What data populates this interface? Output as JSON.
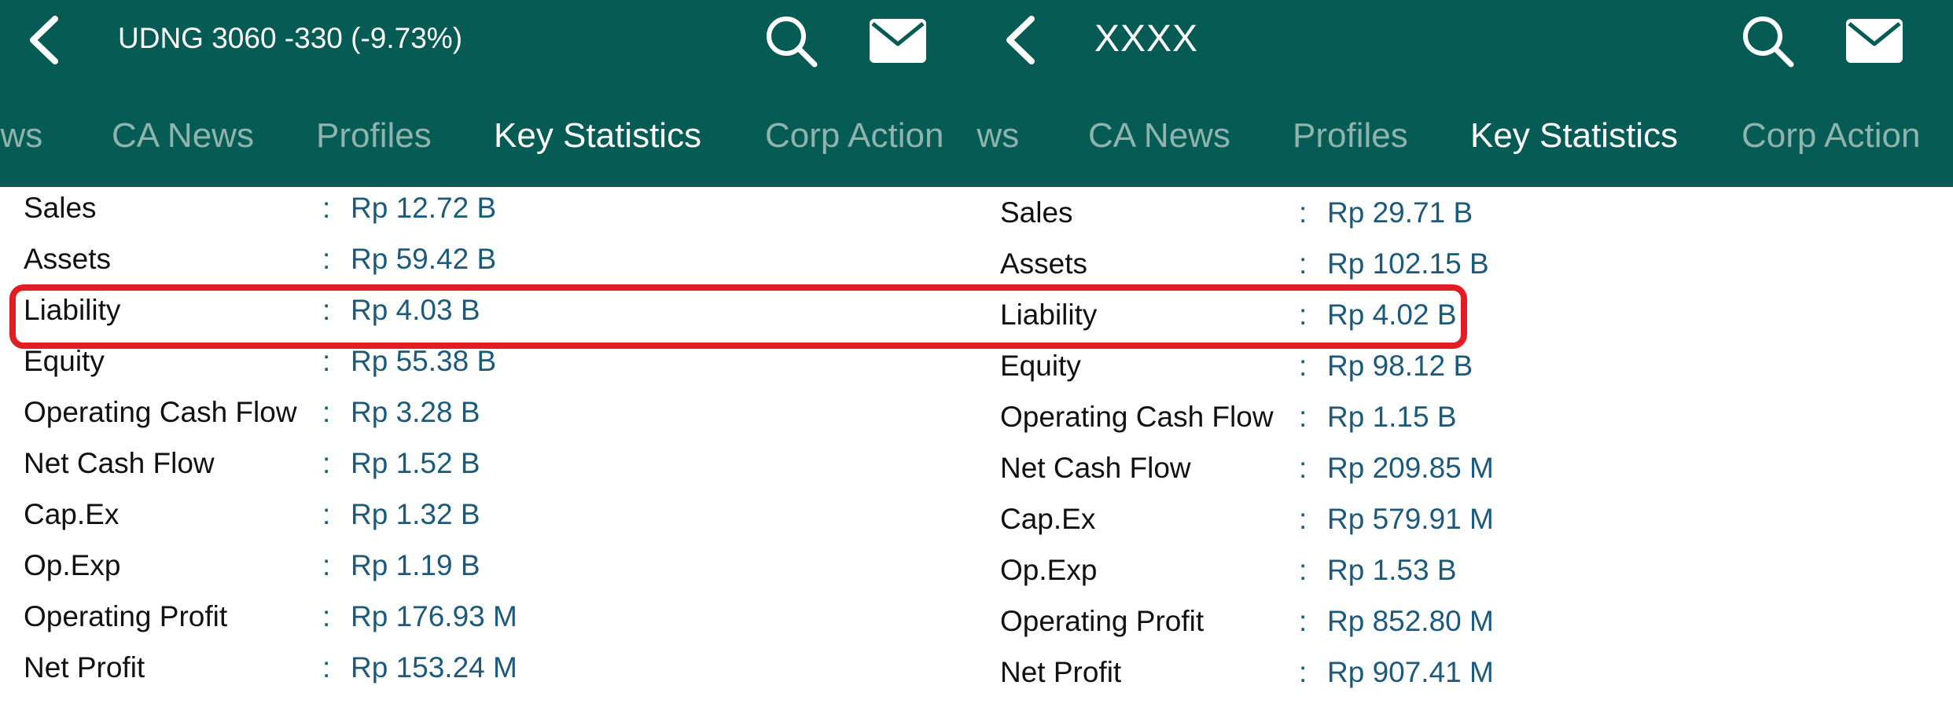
{
  "panels": [
    {
      "title": "UDNG  3060 -330 (-9.73%)",
      "tabs": [
        {
          "label": "ews",
          "active": false
        },
        {
          "label": "CA News",
          "active": false
        },
        {
          "label": "Profiles",
          "active": false
        },
        {
          "label": "Key Statistics",
          "active": true
        },
        {
          "label": "Corp Action",
          "active": false
        }
      ],
      "stats": [
        {
          "label": "Sales",
          "value": "Rp 12.72 B"
        },
        {
          "label": "Assets",
          "value": "Rp 59.42 B"
        },
        {
          "label": "Liability",
          "value": "Rp 4.03 B"
        },
        {
          "label": "Equity",
          "value": "Rp 55.38 B"
        },
        {
          "label": "Operating Cash Flow",
          "value": "Rp 3.28 B"
        },
        {
          "label": "Net Cash Flow",
          "value": "Rp 1.52 B"
        },
        {
          "label": "Cap.Ex",
          "value": "Rp 1.32 B"
        },
        {
          "label": "Op.Exp",
          "value": "Rp 1.19 B"
        },
        {
          "label": "Operating Profit",
          "value": "Rp 176.93 M"
        },
        {
          "label": "Net Profit",
          "value": "Rp 153.24 M"
        }
      ]
    },
    {
      "title": "XXXX",
      "tabs": [
        {
          "label": "ews",
          "active": false
        },
        {
          "label": "CA News",
          "active": false
        },
        {
          "label": "Profiles",
          "active": false
        },
        {
          "label": "Key Statistics",
          "active": true
        },
        {
          "label": "Corp Action",
          "active": false
        }
      ],
      "stats": [
        {
          "label": "Sales",
          "value": "Rp 29.71 B"
        },
        {
          "label": "Assets",
          "value": "Rp 102.15 B"
        },
        {
          "label": "Liability",
          "value": "Rp 4.02 B"
        },
        {
          "label": "Equity",
          "value": "Rp 98.12 B"
        },
        {
          "label": "Operating Cash Flow",
          "value": "Rp 1.15 B"
        },
        {
          "label": "Net Cash Flow",
          "value": "Rp 209.85 M"
        },
        {
          "label": "Cap.Ex",
          "value": "Rp 579.91 M"
        },
        {
          "label": "Op.Exp",
          "value": "Rp 1.53 B"
        },
        {
          "label": "Operating Profit",
          "value": "Rp 852.80 M"
        },
        {
          "label": "Net Profit",
          "value": "Rp 907.41 M"
        }
      ]
    }
  ],
  "separator": ":",
  "icons": {
    "back": "chevron-left-icon",
    "search": "search-icon",
    "mail": "mail-icon"
  },
  "colors": {
    "header": "#065c54",
    "tab_inactive": "#8fb4ae",
    "value": "#1d5a7a",
    "highlight": "#e01e23"
  }
}
